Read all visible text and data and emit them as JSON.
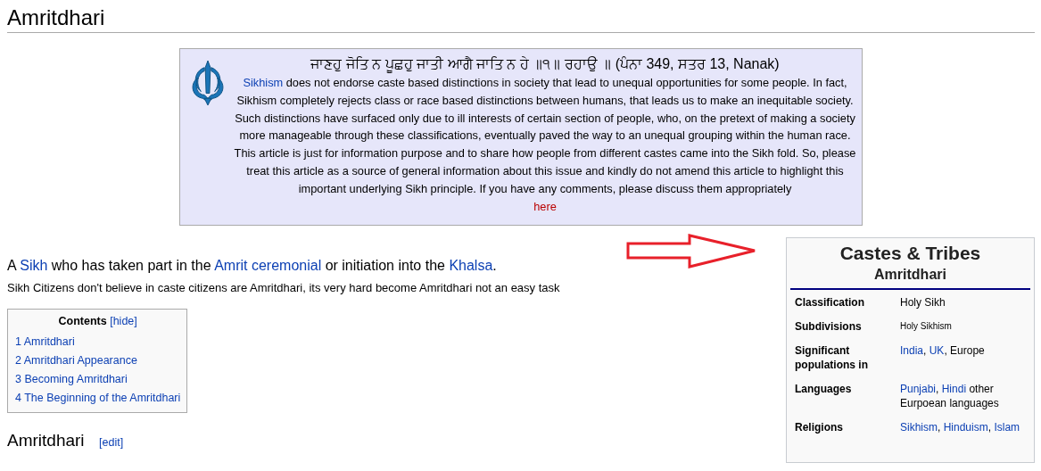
{
  "page_title": "Amritdhari",
  "notice": {
    "heading": "ਜਾਣਹੁ ਜੋਤਿ ਨ ਪੂਛਹੁ ਜਾਤੀ ਆਗੈ ਜਾਤਿ ਨ ਹੇ ॥੧॥ ਰਹਾਉ ॥ (ਪੰਨਾ 349, ਸਤਰ 13, Nanak)",
    "body": [
      {
        "text": "Sikhism",
        "link": true
      },
      {
        "text": " does not endorse caste based distinctions in society that lead to unequal opportunities for some people. In fact, Sikhism completely rejects class or race based distinctions between humans, that leads us to make an inequitable society. Such distinctions have surfaced only due to ill interests of certain section of people, who, on the pretext of making a society more manageable through these classifications, eventually paved the way to an unequal grouping within the human race. This article is just for information purpose and to share how people from different castes came into the Sikh fold. So, please treat this article as a source of general information about this issue and kindly do not amend this article to highlight this important underlying Sikh principle. If you have any comments, please discuss them appropriately",
        "link": false
      }
    ],
    "link": "here"
  },
  "lead": [
    {
      "text": "A ",
      "link": false
    },
    {
      "text": "Sikh",
      "link": true
    },
    {
      "text": " who has taken part in the ",
      "link": false
    },
    {
      "text": "Amrit ceremonial",
      "link": true
    },
    {
      "text": " or initiation into the ",
      "link": false
    },
    {
      "text": "Khalsa",
      "link": true
    },
    {
      "text": ".",
      "link": false
    }
  ],
  "note": "Sikh Citizens don't believe in caste citizens are Amritdhari, its very hard become Amritdhari not an easy task",
  "contents": {
    "title": "Contents",
    "toggle": "[hide]",
    "items": [
      "1 Amritdhari",
      "2 Amritdhari Appearance",
      "3 Becoming Amritdhari",
      "4 The Beginning of the Amritdhari"
    ]
  },
  "section": {
    "heading": "Amritdhari",
    "edit": "[edit]"
  },
  "infobox": {
    "title": "Castes & Tribes",
    "subtitle": "Amritdhari",
    "rows": [
      {
        "label": "Classification",
        "small": false,
        "value": [
          {
            "text": "Holy Sikh",
            "link": false
          }
        ]
      },
      {
        "label": "Subdivisions",
        "small": true,
        "value": [
          {
            "text": "Holy Sikhism",
            "link": false
          }
        ]
      },
      {
        "label": "Significant populations in",
        "small": false,
        "value": [
          {
            "text": "India",
            "link": true
          },
          {
            "text": ", ",
            "link": false
          },
          {
            "text": "UK",
            "link": true
          },
          {
            "text": ", Europe",
            "link": false
          }
        ]
      },
      {
        "label": "Languages",
        "small": false,
        "value": [
          {
            "text": "Punjabi",
            "link": true
          },
          {
            "text": ", ",
            "link": false
          },
          {
            "text": "Hindi",
            "link": true
          },
          {
            "text": " other Eurpoean languages",
            "link": false
          }
        ]
      },
      {
        "label": "Religions",
        "small": false,
        "value": [
          {
            "text": "Sikhism",
            "link": true
          },
          {
            "text": ", ",
            "link": false
          },
          {
            "text": "Hinduism",
            "link": true
          },
          {
            "text": ", ",
            "link": false
          },
          {
            "text": "Islam",
            "link": true
          }
        ]
      }
    ]
  }
}
